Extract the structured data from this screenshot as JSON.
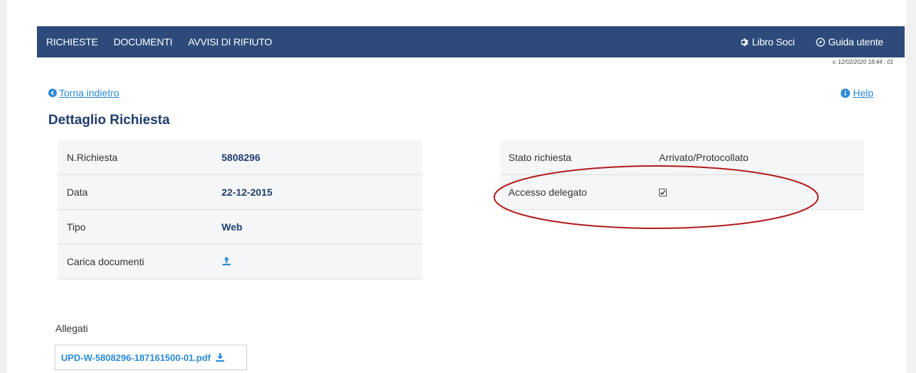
{
  "nav": {
    "items": [
      {
        "label": "RICHIESTE"
      },
      {
        "label": "DOCUMENTI"
      },
      {
        "label": "AVVISI DI RIFIUTO"
      }
    ],
    "libro_soci": "Libro Soci",
    "guida_utente": "Guida utente"
  },
  "version": "v. 12/02/2020 18:44 : 01",
  "back_link": "Torna indietro",
  "help_link": "Help",
  "page_title": "Dettaglio Richiesta",
  "details_left": [
    {
      "label": "N.Richiesta",
      "value": "5808296"
    },
    {
      "label": "Data",
      "value": "22-12-2015"
    },
    {
      "label": "Tipo",
      "value": "Web"
    },
    {
      "label": "Carica documenti",
      "value": ""
    }
  ],
  "details_right": [
    {
      "label": "Stato richiesta",
      "value": "Arrivato/Protocollato"
    },
    {
      "label": "Accesso delegato",
      "checked": true
    }
  ],
  "attachments": {
    "label": "Allegati",
    "files": [
      {
        "name": "UPD-W-5808296-187161500-01.pdf"
      }
    ]
  },
  "colors": {
    "navbar": "#2d4a7a",
    "link": "#2b8ad6",
    "title": "#1f3d6d",
    "annotation": "#b11a1a"
  }
}
